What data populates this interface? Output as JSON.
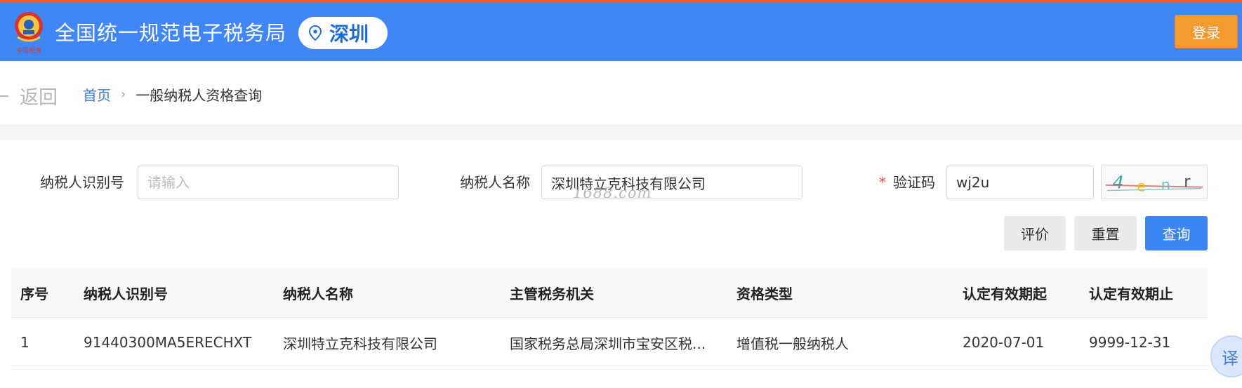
{
  "header": {
    "emblem_text": "中国税务",
    "site_title": "全国统一规范电子税务局",
    "city": "深圳",
    "login_label": "登录",
    "icons": {
      "location": "map-pin-icon",
      "emblem": "tax-emblem-icon"
    }
  },
  "breadcrumb": {
    "back_label": "返回",
    "home": "首页",
    "separator": "›",
    "current": "一般纳税人资格查询"
  },
  "form": {
    "taxpayer_id": {
      "label": "纳税人识别号",
      "value": "",
      "placeholder": "请输入"
    },
    "taxpayer_name": {
      "label": "纳税人名称",
      "value": "深圳特立克科技有限公司",
      "placeholder": ""
    },
    "captcha": {
      "required_mark": "*",
      "label": "验证码",
      "value": "wj2u",
      "image_text": "4enr"
    },
    "watermark": "1688.com"
  },
  "actions": {
    "evaluate": "评价",
    "reset": "重置",
    "query": "查询"
  },
  "table": {
    "columns": [
      "序号",
      "纳税人识别号",
      "纳税人名称",
      "主管税务机关",
      "资格类型",
      "认定有效期起",
      "认定有效期止"
    ],
    "rows": [
      [
        "1",
        "91440300MA5ERECHXT",
        "深圳特立克科技有限公司",
        "国家税务总局深圳市宝安区税...",
        "增值税一般纳税人",
        "2020-07-01",
        "9999-12-31"
      ]
    ]
  },
  "floating": {
    "translate_label": "译"
  },
  "colors": {
    "header_bg": "#4186f5",
    "login_bg": "#f59a2e",
    "primary_button": "#3c87f3",
    "required": "#e04b4b"
  }
}
